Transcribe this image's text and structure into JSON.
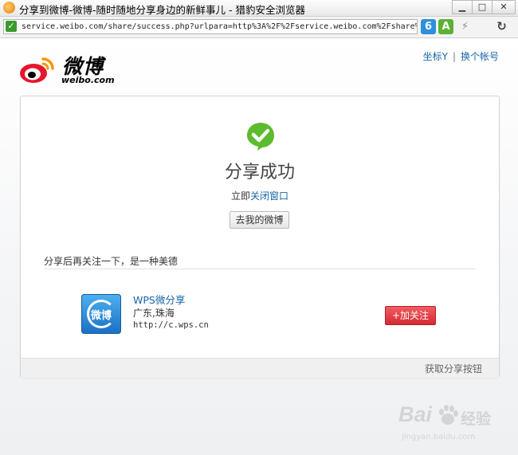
{
  "window": {
    "title": "分享到微博-微博-随时随地分享身边的新鲜事儿 - 猎豹安全浏览器",
    "minimize": "▁",
    "maximize": "□",
    "close": "✕"
  },
  "address_bar": {
    "url": "service.weibo.com/share/success.php?urlpara=http%3A%2F%2Fservice.weibo.com%2Fshare%",
    "refresh": "↻"
  },
  "header": {
    "logo_cn": "微博",
    "logo_en": "weibo.com",
    "user_link": "坐标Y",
    "switch_link": "换个帐号",
    "separator": "|"
  },
  "result": {
    "title": "分享成功",
    "close_prefix": "立即",
    "close_link": "关闭窗口",
    "go_button": "去我的微博"
  },
  "follow": {
    "tip": "分享后再关注一下，是一种美德",
    "account_name": "WPS微分享",
    "account_location": "广东,珠海",
    "account_url": "http://c.wps.cn",
    "logo_text": "微博",
    "follow_button": "+加关注"
  },
  "footer": {
    "get_share_button": "获取分享按钮"
  },
  "watermark": {
    "brand": "Bai",
    "brand_cn": "经验",
    "site": "jingyan.baidu.com"
  }
}
